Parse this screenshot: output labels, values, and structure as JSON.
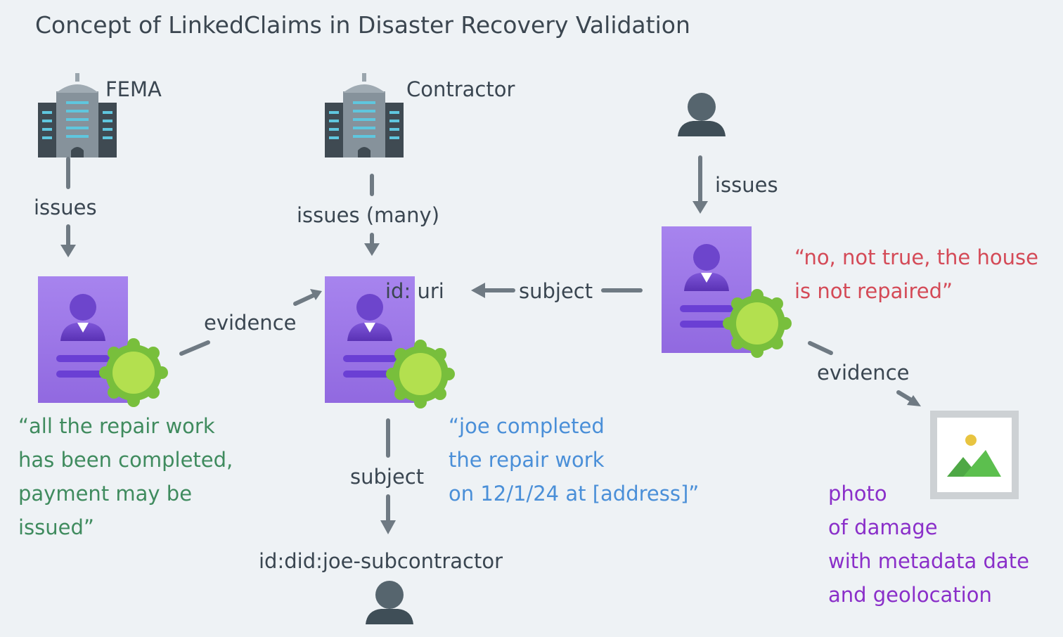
{
  "title": "Concept of LinkedClaims in Disaster Recovery Validation",
  "issuers": {
    "fema": "FEMA",
    "contractor": "Contractor"
  },
  "edges": {
    "fema_issues": "issues",
    "contractor_issues": "issues (many)",
    "person_issues": "issues",
    "evidence_left": "evidence",
    "subject_arrow": "subject",
    "evidence_right": "evidence",
    "subject_down": "subject"
  },
  "credential_ids": {
    "middle": "id: uri",
    "subcontractor": "id:did:joe-subcontractor"
  },
  "claims": {
    "fema": [
      "“all the repair work",
      "has been completed,",
      "payment may be",
      "issued”"
    ],
    "contractor": [
      "“joe completed",
      "the repair work",
      "on 12/1/24 at [address]”"
    ],
    "homeowner": [
      "“no, not true, the house",
      "is not repaired”"
    ]
  },
  "photo_caption": [
    "photo",
    "of damage",
    "with metadata date",
    "and geolocation"
  ],
  "icons": {
    "building": "government-building-icon",
    "person": "person-icon",
    "credential": "verifiable-credential-icon",
    "seal": "seal-badge-icon",
    "photo": "image-icon"
  },
  "colors": {
    "credential": "#9d77e8",
    "seal": "#a6d844",
    "arrow": "#6f7a83",
    "fema_claim": "#3f8b5e",
    "contractor_claim": "#4a8fd8",
    "homeowner_claim": "#d44a57",
    "photo_caption": "#8a2fc9"
  }
}
